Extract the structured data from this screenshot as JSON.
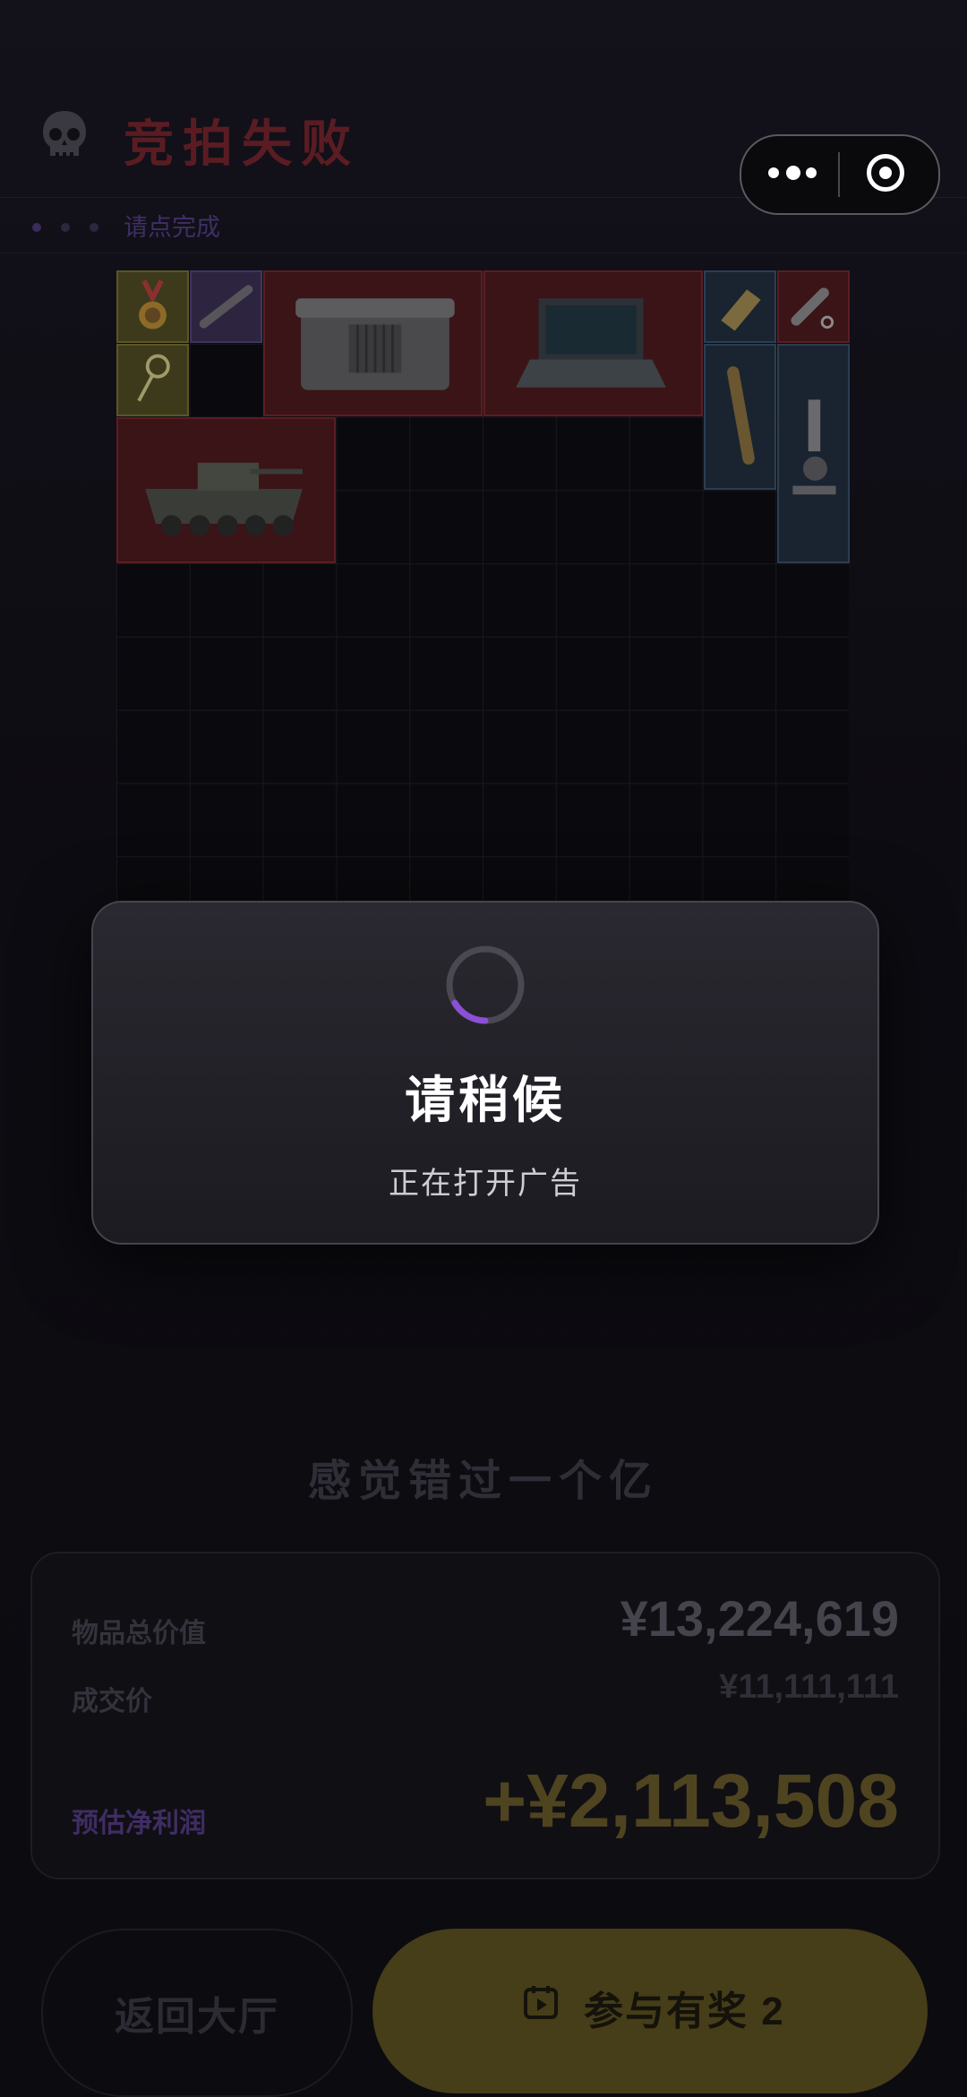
{
  "header": {
    "title": "竞拍失败",
    "hint": "请点完成"
  },
  "capsule": {
    "more_icon": "more-dots-icon",
    "close_icon": "target-circle-icon"
  },
  "grid": {
    "items": [
      {
        "name": "medal-item",
        "rarity": "gold"
      },
      {
        "name": "rifle-scope-item",
        "rarity": "purple"
      },
      {
        "name": "military-crate-item",
        "rarity": "red"
      },
      {
        "name": "rugged-laptop-item",
        "rarity": "red"
      },
      {
        "name": "gold-bar-item",
        "rarity": "blue"
      },
      {
        "name": "flashlight-item",
        "rarity": "red"
      },
      {
        "name": "key-item",
        "rarity": "gold"
      },
      {
        "name": "scroll-tube-item",
        "rarity": "blue"
      },
      {
        "name": "microscope-item",
        "rarity": "blue"
      },
      {
        "name": "armored-vehicle-item",
        "rarity": "red"
      }
    ]
  },
  "modal": {
    "title": "请稍候",
    "subtitle": "正在打开广告",
    "spinner_color": "#8b4fd8"
  },
  "result": {
    "slogan": "感觉错过一个亿",
    "total_label": "物品总价值",
    "total_value": "¥13,224,619",
    "deal_label": "成交价",
    "deal_value": "¥11,111,111",
    "profit_label": "预估净利润",
    "profit_value": "+¥2,113,508"
  },
  "buttons": {
    "back_label": "返回大厅",
    "join_label": "参与有奖 2"
  }
}
